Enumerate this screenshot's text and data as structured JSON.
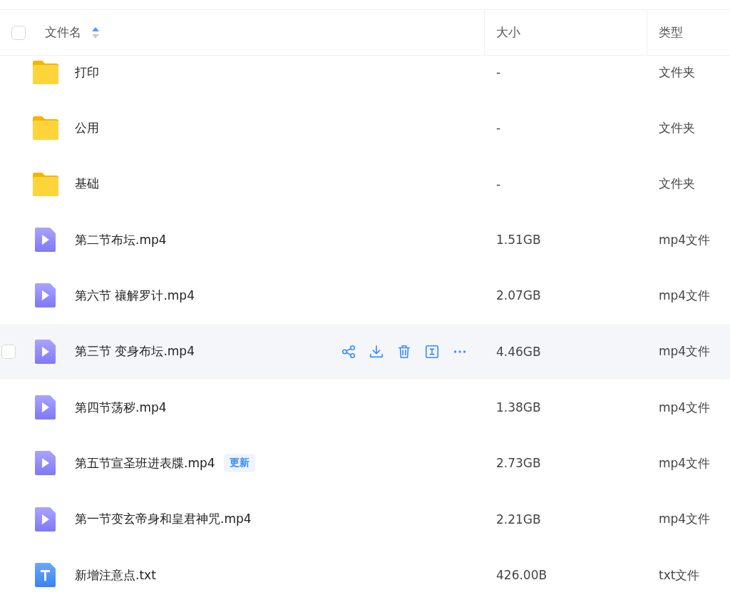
{
  "table": {
    "select_all": {
      "checked": false
    },
    "columns": [
      {
        "label": "文件名",
        "sorted": true
      },
      {
        "label": "大小",
        "sorted": false
      },
      {
        "label": "类型",
        "sorted": false
      }
    ],
    "rows": [
      {
        "kind": "folder",
        "name": "打印",
        "size": "-",
        "type": "文件夹",
        "hovered": false
      },
      {
        "kind": "folder",
        "name": "公用",
        "size": "-",
        "type": "文件夹",
        "hovered": false
      },
      {
        "kind": "folder",
        "name": "基础",
        "size": "-",
        "type": "文件夹",
        "hovered": false
      },
      {
        "kind": "video",
        "name": "第二节布坛.mp4",
        "size": "1.51GB",
        "type": "mp4文件",
        "hovered": false
      },
      {
        "kind": "video",
        "name": "第六节 禳解罗计.mp4",
        "size": "2.07GB",
        "type": "mp4文件",
        "hovered": false
      },
      {
        "kind": "video",
        "name": "第三节 变身布坛.mp4",
        "size": "4.46GB",
        "type": "mp4文件",
        "hovered": true,
        "checked": false
      },
      {
        "kind": "video",
        "name": "第四节荡秽.mp4",
        "size": "1.38GB",
        "type": "mp4文件",
        "hovered": false
      },
      {
        "kind": "video",
        "name": "第五节宣圣班进表牒.mp4",
        "badge": "更新",
        "size": "2.73GB",
        "type": "mp4文件",
        "hovered": false
      },
      {
        "kind": "video",
        "name": "第一节变玄帝身和皇君神咒.mp4",
        "size": "2.21GB",
        "type": "mp4文件",
        "hovered": false
      },
      {
        "kind": "text",
        "name": "新增注意点.txt",
        "size": "426.00B",
        "type": "txt文件",
        "hovered": false
      }
    ]
  }
}
